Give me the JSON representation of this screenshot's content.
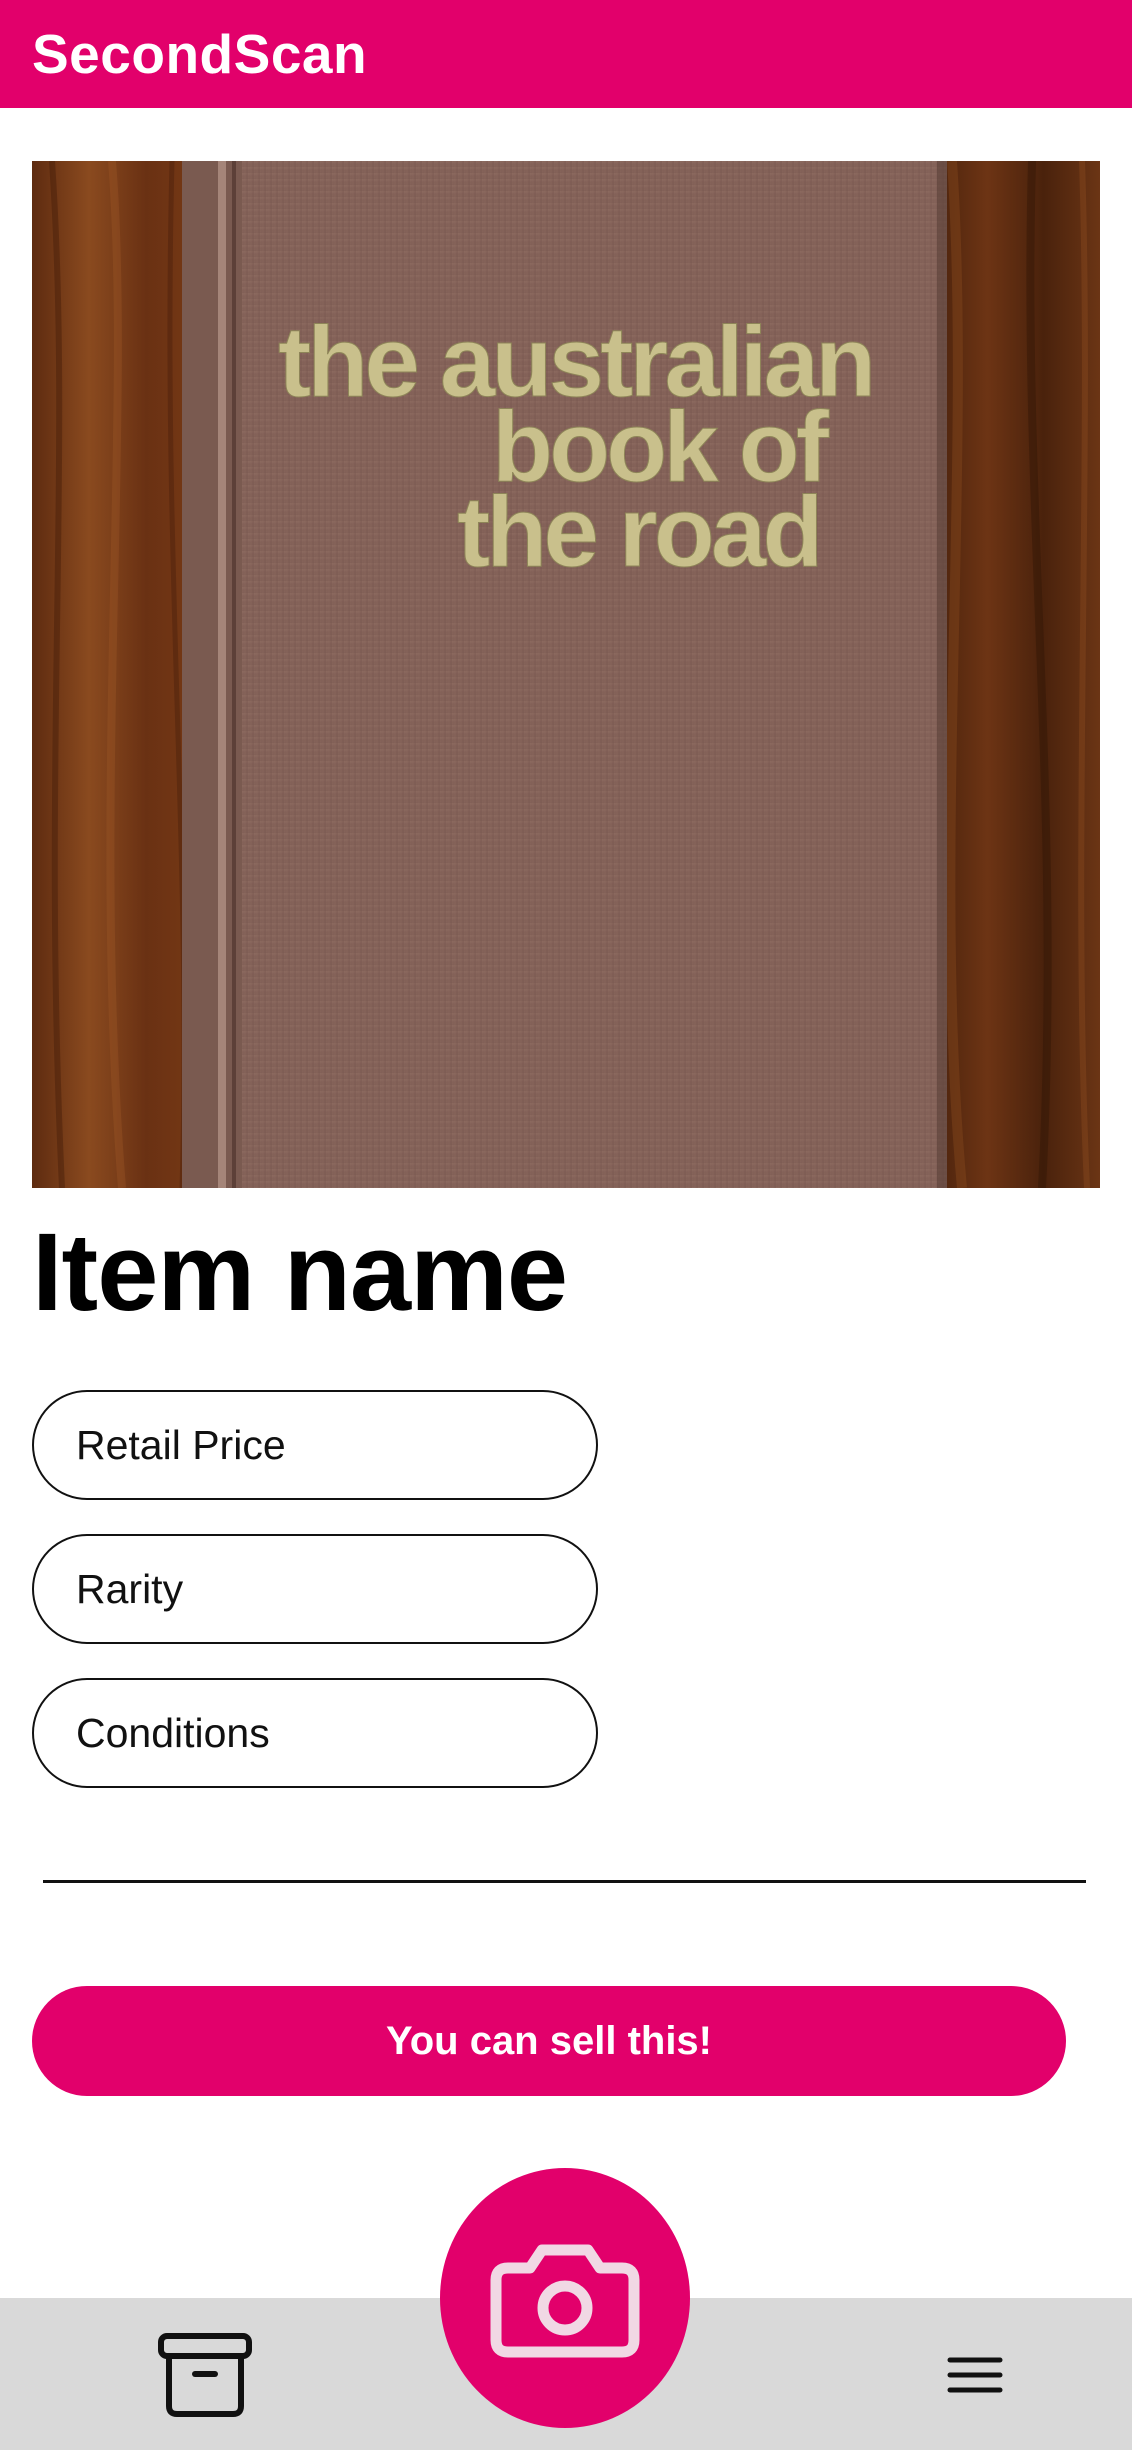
{
  "app": {
    "title": "SecondScan",
    "accent_color": "#e2006b"
  },
  "photo": {
    "book_title_lines": [
      "the australian",
      "book of",
      "the road"
    ]
  },
  "item": {
    "name": "Item name"
  },
  "fields": {
    "retail_price": "Retail Price",
    "rarity": "Rarity",
    "conditions": "Conditions"
  },
  "actions": {
    "sell_label": "You can sell this!"
  },
  "nav": {
    "left_icon": "archive-icon",
    "center_icon": "camera-icon",
    "right_icon": "menu-icon"
  }
}
